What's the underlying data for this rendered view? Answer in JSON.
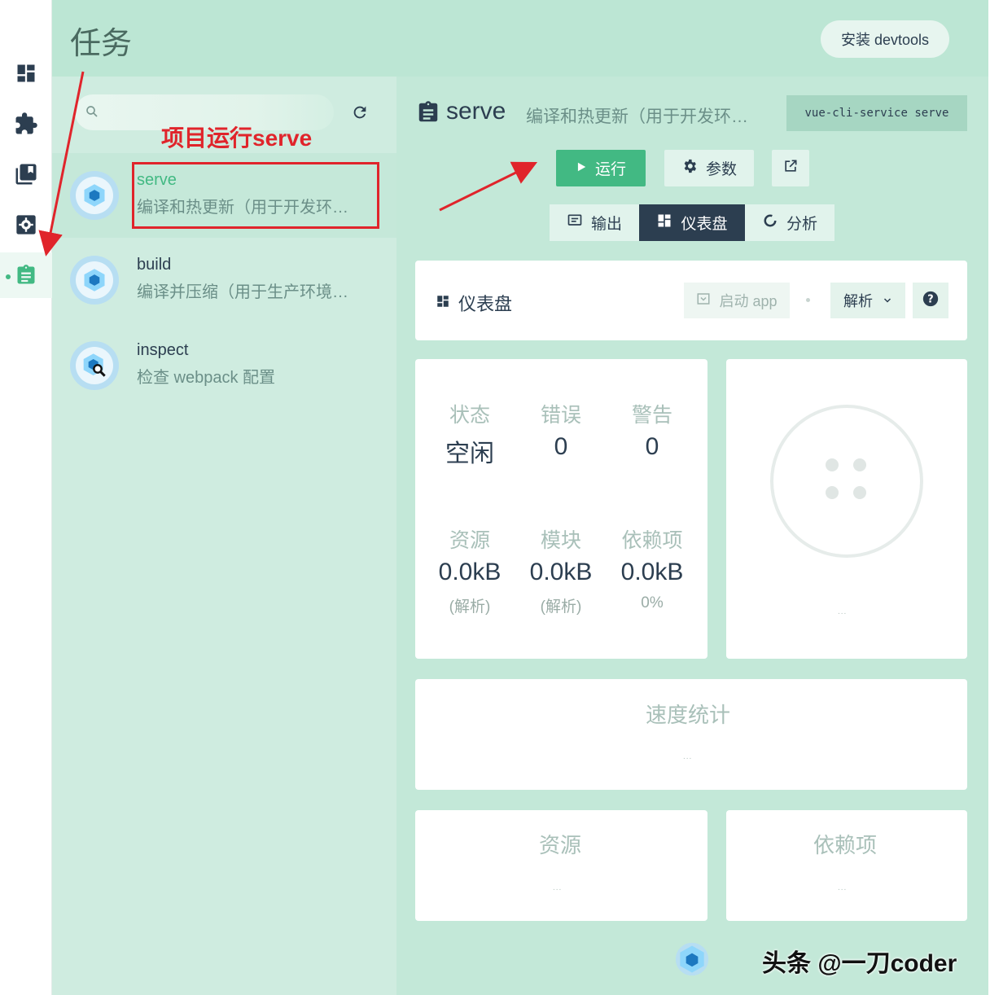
{
  "header": {
    "title": "任务",
    "devtools_button": "安装 devtools"
  },
  "sidebar_rail": {
    "icons": [
      "dashboard-icon",
      "plugins-icon",
      "dependencies-icon",
      "configuration-icon",
      "tasks-icon"
    ],
    "active": "tasks-icon"
  },
  "task_list": {
    "search_placeholder": "",
    "tasks": [
      {
        "name": "serve",
        "description": "编译和热更新（用于开发环…"
      },
      {
        "name": "build",
        "description": "编译并压缩（用于生产环境…"
      },
      {
        "name": "inspect",
        "description": "检查 webpack 配置"
      }
    ]
  },
  "annotation": {
    "label": "项目运行serve"
  },
  "task_detail": {
    "name": "serve",
    "description": "编译和热更新（用于开发环…",
    "command": "vue-cli-service serve",
    "buttons": {
      "run": "运行",
      "params": "参数"
    },
    "tabs": [
      "输出",
      "仪表盘",
      "分析"
    ],
    "active_tab": "仪表盘"
  },
  "dashboard": {
    "title": "仪表盘",
    "start_app": "启动 app",
    "select_value": "解析",
    "stats": [
      {
        "label": "状态",
        "value": "空闲",
        "sub": ""
      },
      {
        "label": "错误",
        "value": "0",
        "sub": ""
      },
      {
        "label": "警告",
        "value": "0",
        "sub": ""
      },
      {
        "label": "资源",
        "value": "0.0kB",
        "sub": "(解析)"
      },
      {
        "label": "模块",
        "value": "0.0kB",
        "sub": "(解析)"
      },
      {
        "label": "依赖项",
        "value": "0.0kB",
        "sub": "0%"
      }
    ],
    "placeholder_dots": "...",
    "speed_title": "速度统计",
    "assets_title": "资源",
    "deps_title": "依赖项"
  },
  "watermark": "头条 @一刀coder",
  "colors": {
    "accent": "#42b983",
    "dark": "#2c3e50",
    "annotation": "#e0242b"
  }
}
